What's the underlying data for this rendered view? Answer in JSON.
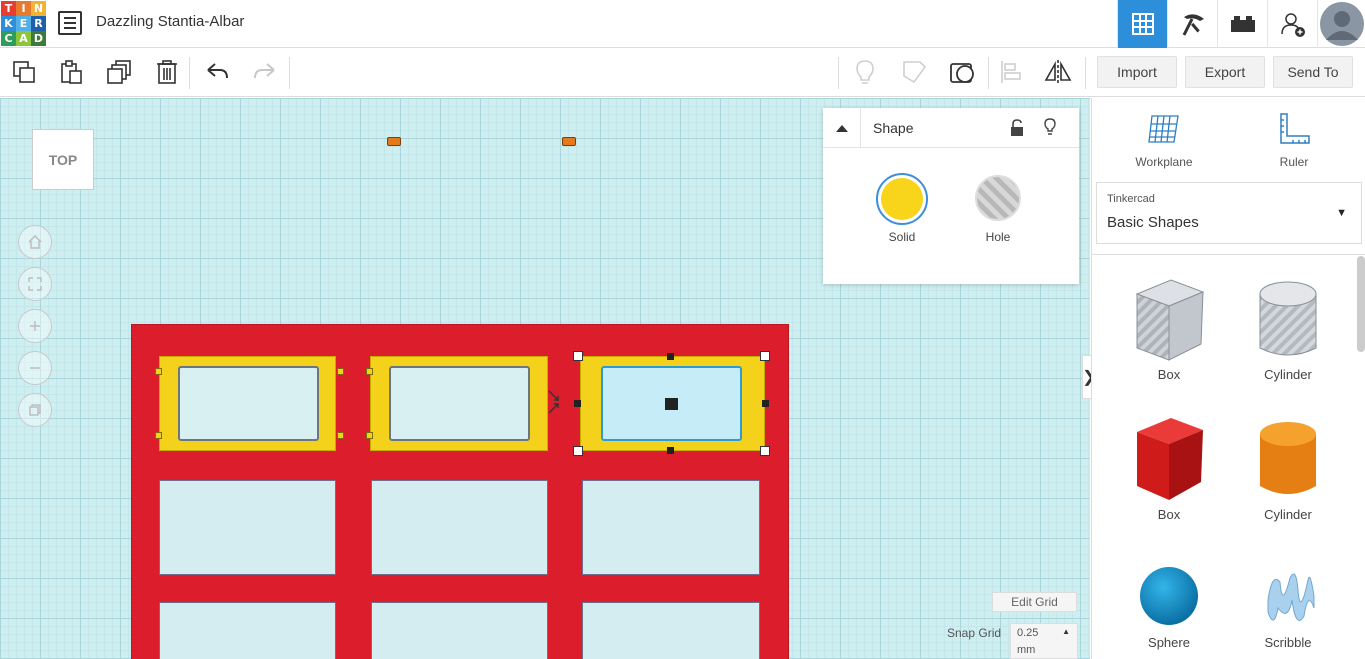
{
  "app": {
    "logo_letters": [
      "T",
      "I",
      "N",
      "K",
      "E",
      "R",
      "C",
      "A",
      "D"
    ],
    "logo_colors": [
      "#e63d2f",
      "#e67a2f",
      "#f2b233",
      "#2d8ed9",
      "#52b0e6",
      "#1e5eab",
      "#2e9d5b",
      "#8cc63f",
      "#3e7a3a"
    ],
    "title": "Dazzling Stantia-Albar"
  },
  "header_buttons": [
    {
      "name": "3d-view-icon",
      "active": true
    },
    {
      "name": "pickaxe-icon",
      "active": false
    },
    {
      "name": "bricks-icon",
      "active": false
    },
    {
      "name": "add-user-icon",
      "active": false
    },
    {
      "name": "avatar",
      "active": false
    }
  ],
  "toolbar": {
    "tools": [
      "copy-icon",
      "paste-icon",
      "duplicate-icon",
      "delete-icon",
      "undo-icon",
      "redo-icon"
    ],
    "right_tools": [
      "lightbulb-icon",
      "note-icon",
      "workplane-drop-icon",
      "align-icon",
      "mirror-icon"
    ],
    "import_label": "Import",
    "export_label": "Export",
    "send_to_label": "Send To"
  },
  "viewcube": {
    "label": "TOP"
  },
  "nav_buttons": [
    "home-icon",
    "fit-view-icon",
    "zoom-in-icon",
    "zoom-out-icon",
    "perspective-icon"
  ],
  "shape_panel": {
    "title": "Shape",
    "solid_label": "Solid",
    "hole_label": "Hole",
    "solid_color": "#f8d41a"
  },
  "grid": {
    "edit_grid_label": "Edit Grid",
    "snap_grid_label": "Snap Grid",
    "snap_value": "0.25",
    "snap_unit": "mm"
  },
  "sidebar": {
    "workplane_label": "Workplane",
    "ruler_label": "Ruler",
    "library_source": "Tinkercad",
    "library_name": "Basic Shapes",
    "shapes": [
      {
        "label": "Box",
        "kind": "box-hole"
      },
      {
        "label": "Cylinder",
        "kind": "cylinder-hole"
      },
      {
        "label": "Box",
        "kind": "box-red"
      },
      {
        "label": "Cylinder",
        "kind": "cylinder-orange"
      },
      {
        "label": "Sphere",
        "kind": "sphere"
      },
      {
        "label": "Scribble",
        "kind": "scribble"
      }
    ]
  },
  "colors": {
    "accent": "#2d8ed9",
    "base_red": "#dc1e2c",
    "frame_yellow": "#f4d21c",
    "workplane": "#cfeef0"
  }
}
